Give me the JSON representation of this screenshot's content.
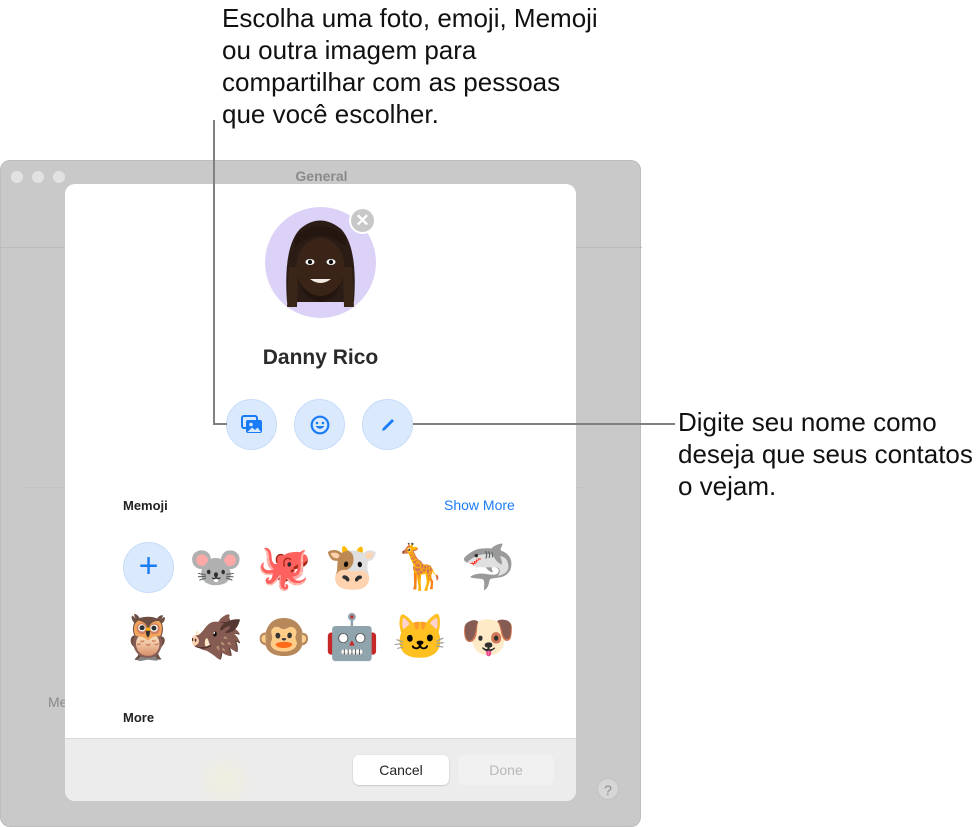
{
  "callouts": {
    "top": "Escolha uma foto, emoji, Memoji ou outra imagem para compartilhar com as pessoas que você escolher.",
    "right": "Digite seu nome como deseja que seus contatos o vejam."
  },
  "window": {
    "title": "General",
    "partial_label": "Me",
    "help_label": "?"
  },
  "sheet": {
    "user_name": "Danny Rico",
    "avatar_icon": "memoji-avatar",
    "remove_icon": "✕",
    "actions": [
      {
        "name": "photos",
        "icon": "photos-icon"
      },
      {
        "name": "emoji",
        "icon": "smiley-icon"
      },
      {
        "name": "edit-name",
        "icon": "pencil-icon"
      }
    ],
    "memoji_section": {
      "label": "Memoji",
      "show_more": "Show More",
      "add_label": "+",
      "items": [
        "🐭",
        "🐙",
        "🐮",
        "🦒",
        "🦈",
        "🦉",
        "🐗",
        "🐵",
        "🤖",
        "🐱",
        "🐶"
      ],
      "item_names": [
        "mouse",
        "octopus",
        "cow",
        "giraffe",
        "shark",
        "owl",
        "boar",
        "monkey",
        "robot",
        "cat",
        "dog"
      ]
    },
    "more_section": {
      "label": "More"
    },
    "buttons": {
      "cancel": "Cancel",
      "done": "Done"
    }
  },
  "colors": {
    "accent": "#1a7cf5",
    "action_bg": "#dbe9fd",
    "avatar_bg": "#dcd2f7"
  }
}
